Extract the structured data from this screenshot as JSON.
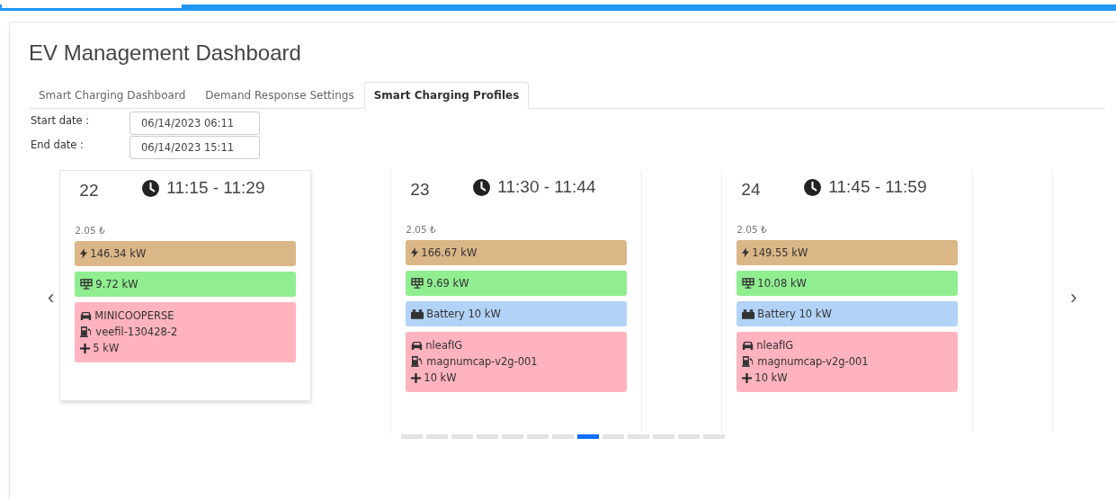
{
  "title": "EV Management Dashboard",
  "tabs": [
    {
      "label": "Smart Charging Dashboard",
      "selected": false
    },
    {
      "label": "Demand Response Settings",
      "selected": false
    },
    {
      "label": "Smart Charging Profiles",
      "selected": true
    }
  ],
  "filters": [
    {
      "label": "Start date :",
      "value": "06/14/2023 06:11"
    },
    {
      "label": "End date :",
      "value": "06/14/2023 15:11"
    }
  ],
  "carousel": {
    "prev": "‹",
    "next": "›",
    "slots": [
      {
        "index": "22",
        "time": "11:15 - 11:29",
        "price": "2.05 ₺",
        "raised": true,
        "blocks": [
          {
            "kind": "grid",
            "text": "146.34 kW"
          },
          {
            "kind": "solar",
            "text": "9.72 kW"
          },
          {
            "kind": "vehicle",
            "car": "MINICOOPERSE",
            "charger": "veefil-130428-2",
            "power": "5 kW"
          }
        ]
      },
      {
        "index": "23",
        "time": "11:30 - 11:44",
        "price": "2.05 ₺",
        "raised": false,
        "blocks": [
          {
            "kind": "grid",
            "text": "166.67 kW"
          },
          {
            "kind": "solar",
            "text": "9.69 kW"
          },
          {
            "kind": "battery",
            "text": "Battery 10 kW"
          },
          {
            "kind": "vehicle",
            "car": "nleafIG",
            "charger": "magnumcap-v2g-001",
            "power": "10 kW"
          }
        ]
      },
      {
        "index": "24",
        "time": "11:45 - 11:59",
        "price": "2.05 ₺",
        "raised": false,
        "blocks": [
          {
            "kind": "grid",
            "text": "149.55 kW"
          },
          {
            "kind": "solar",
            "text": "10.08 kW"
          },
          {
            "kind": "battery",
            "text": "Battery 10 kW"
          },
          {
            "kind": "vehicle",
            "car": "nleafIG",
            "charger": "magnumcap-v2g-001",
            "power": "10 kW"
          }
        ]
      }
    ],
    "indicators": [
      {
        "selected": false
      },
      {
        "selected": false
      },
      {
        "selected": false
      },
      {
        "selected": false
      },
      {
        "selected": false
      },
      {
        "selected": false
      },
      {
        "selected": false
      },
      {
        "selected": true
      },
      {
        "selected": false
      },
      {
        "selected": false
      },
      {
        "selected": false
      },
      {
        "selected": false
      },
      {
        "selected": false
      }
    ]
  }
}
